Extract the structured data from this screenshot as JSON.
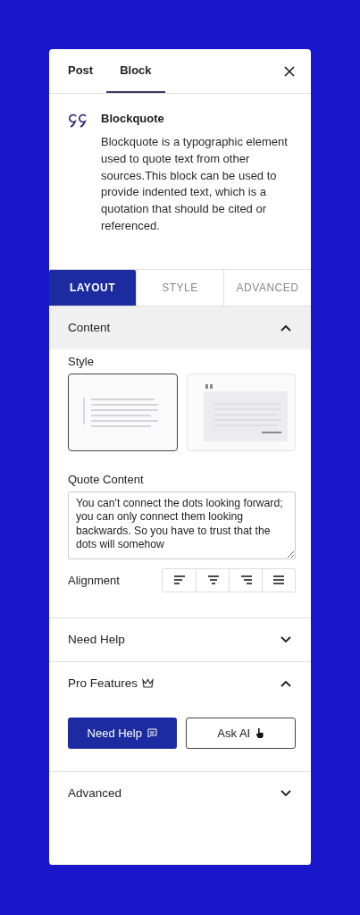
{
  "header_tabs": [
    {
      "label": "Post",
      "selected": false
    },
    {
      "label": "Block",
      "selected": true
    }
  ],
  "block": {
    "title": "Blockquote",
    "description": "Blockquote is a typographic element used to quote text from other sources.This block can be used to provide indented text, which is a quotation that should be cited or referenced."
  },
  "panel_tabs": [
    {
      "label": "LAYOUT",
      "selected": true
    },
    {
      "label": "STYLE",
      "selected": false
    },
    {
      "label": "ADVANCED",
      "selected": false
    }
  ],
  "content": {
    "title": "Content",
    "expanded": true,
    "style_label": "Style",
    "styles": [
      {
        "kind": "plain",
        "selected": true
      },
      {
        "kind": "boxed",
        "selected": false
      }
    ],
    "quote_label": "Quote Content",
    "quote_value": "You can't connect the dots looking forward; you can only connect them looking backwards. So you have to trust that the dots will somehow",
    "alignment_label": "Alignment",
    "alignments": [
      {
        "kind": "left",
        "selected": false
      },
      {
        "kind": "center",
        "selected": false
      },
      {
        "kind": "right",
        "selected": false
      },
      {
        "kind": "justify",
        "selected": false
      }
    ]
  },
  "sections": [
    {
      "title": "Need Help",
      "expanded": false
    },
    {
      "title": "Pro Features",
      "expanded": true,
      "buttons": [
        {
          "label": "Need Help",
          "kind": "primary"
        },
        {
          "label": "Ask AI",
          "kind": "outline"
        }
      ]
    },
    {
      "title": "Advanced",
      "expanded": false
    }
  ]
}
